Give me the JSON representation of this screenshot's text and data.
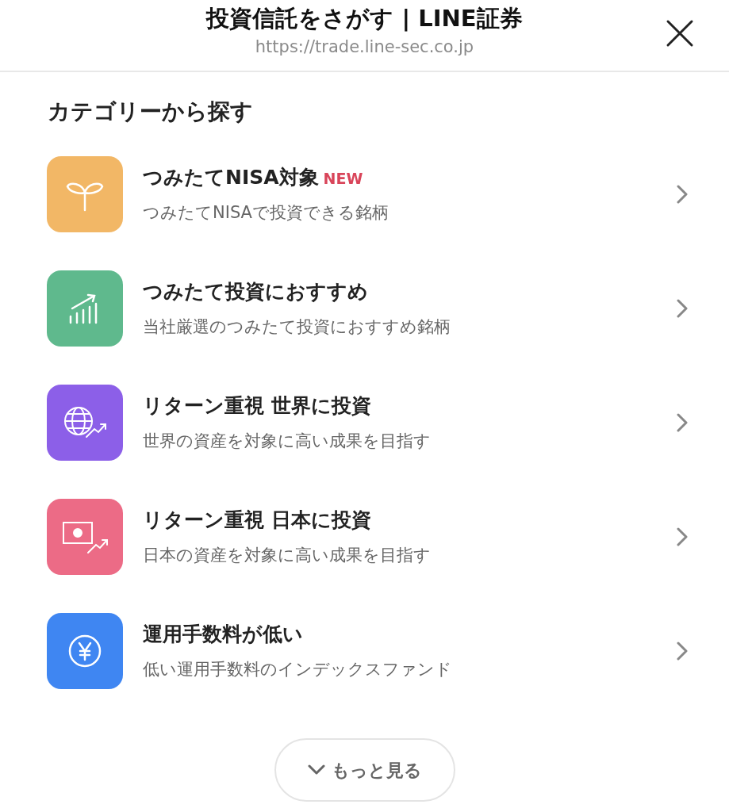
{
  "header": {
    "title": "投資信託をさがす | LINE証券",
    "url": "https://trade.line-sec.co.jp"
  },
  "section_title": "カテゴリーから探す",
  "categories": [
    {
      "title": "つみたてNISA対象",
      "badge": "NEW",
      "subtitle": "つみたてNISAで投資できる銘柄",
      "color": "#f2b766"
    },
    {
      "title": "つみたて投資におすすめ",
      "subtitle": "当社厳選のつみたて投資におすすめ銘柄",
      "color": "#5fb98d"
    },
    {
      "title": "リターン重視 世界に投資",
      "subtitle": "世界の資産を対象に高い成果を目指す",
      "color": "#8c5fe8"
    },
    {
      "title": "リターン重視 日本に投資",
      "subtitle": "日本の資産を対象に高い成果を目指す",
      "color": "#ec6b86"
    },
    {
      "title": "運用手数料が低い",
      "subtitle": "低い運用手数料のインデックスファンド",
      "color": "#3f86f2"
    }
  ],
  "more_button": "もっと見る"
}
